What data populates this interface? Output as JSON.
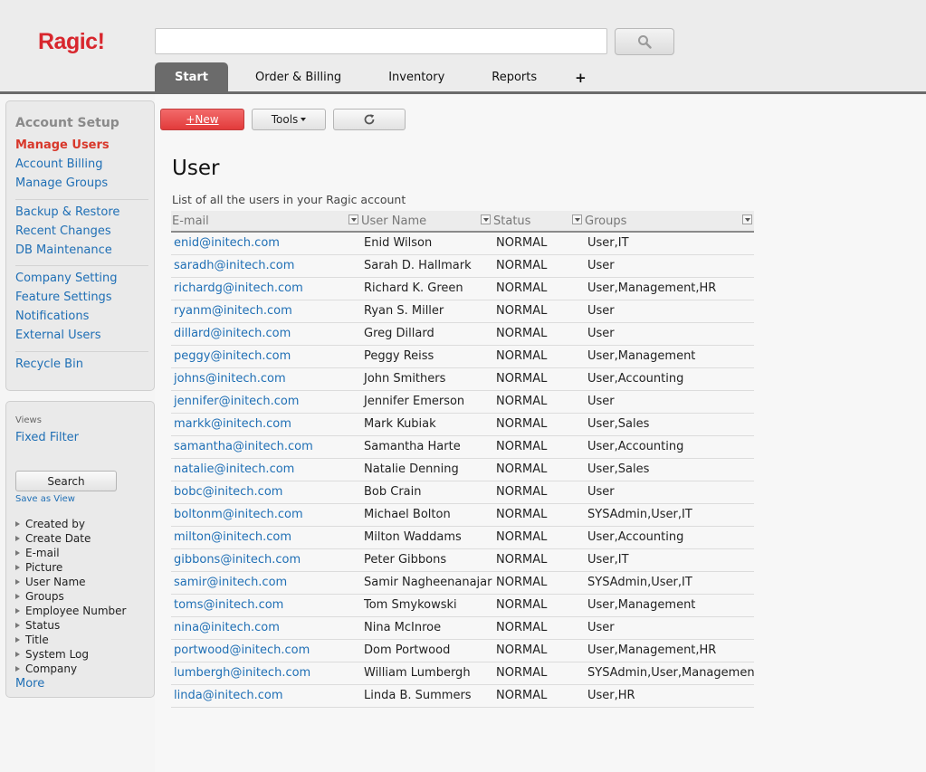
{
  "app": {
    "logo": "Ragic!",
    "search_placeholder": ""
  },
  "tabs": [
    {
      "label": "Start",
      "active": true
    },
    {
      "label": "Order & Billing"
    },
    {
      "label": "Inventory"
    },
    {
      "label": "Reports"
    },
    {
      "label": "+"
    }
  ],
  "sidebar": {
    "title": "Account Setup",
    "groups": [
      [
        "Manage Users",
        "Account Billing",
        "Manage Groups"
      ],
      [
        "Backup & Restore",
        "Recent Changes",
        "DB Maintenance"
      ],
      [
        "Company Setting",
        "Feature Settings",
        "Notifications",
        "External Users"
      ],
      [
        "Recycle Bin"
      ]
    ],
    "active_item": "Manage Users"
  },
  "views": {
    "label": "Views",
    "fixed_filter": "Fixed Filter",
    "search_button": "Search",
    "save_as_view": "Save as View",
    "fields": [
      "Created by",
      "Create Date",
      "E-mail",
      "Picture",
      "User Name",
      "Groups",
      "Employee Number",
      "Status",
      "Title",
      "System Log",
      "Company"
    ],
    "more": "More"
  },
  "toolbar": {
    "new_label": "+New",
    "tools_label": "Tools",
    "refresh_icon": "refresh-icon"
  },
  "main": {
    "title": "User",
    "subtitle": "List of all the users in your Ragic account"
  },
  "table": {
    "columns": [
      "E-mail",
      "User Name",
      "Status",
      "Groups"
    ],
    "rows": [
      [
        "enid@initech.com",
        "Enid Wilson",
        "NORMAL",
        "User,IT"
      ],
      [
        "saradh@initech.com",
        "Sarah D. Hallmark",
        "NORMAL",
        "User"
      ],
      [
        "richardg@initech.com",
        "Richard K. Green",
        "NORMAL",
        "User,Management,HR"
      ],
      [
        "ryanm@initech.com",
        "Ryan S. Miller",
        "NORMAL",
        "User"
      ],
      [
        "dillard@initech.com",
        "Greg Dillard",
        "NORMAL",
        "User"
      ],
      [
        "peggy@initech.com",
        "Peggy Reiss",
        "NORMAL",
        "User,Management"
      ],
      [
        "johns@initech.com",
        "John Smithers",
        "NORMAL",
        "User,Accounting"
      ],
      [
        "jennifer@initech.com",
        "Jennifer Emerson",
        "NORMAL",
        "User"
      ],
      [
        "markk@initech.com",
        "Mark Kubiak",
        "NORMAL",
        "User,Sales"
      ],
      [
        "samantha@initech.com",
        "Samantha Harte",
        "NORMAL",
        "User,Accounting"
      ],
      [
        "natalie@initech.com",
        "Natalie Denning",
        "NORMAL",
        "User,Sales"
      ],
      [
        "bobc@initech.com",
        "Bob Crain",
        "NORMAL",
        "User"
      ],
      [
        "boltonm@initech.com",
        "Michael Bolton",
        "NORMAL",
        "SYSAdmin,User,IT"
      ],
      [
        "milton@initech.com",
        "Milton Waddams",
        "NORMAL",
        "User,Accounting"
      ],
      [
        "gibbons@initech.com",
        "Peter Gibbons",
        "NORMAL",
        "User,IT"
      ],
      [
        "samir@initech.com",
        "Samir Nagheenanajar",
        "NORMAL",
        "SYSAdmin,User,IT"
      ],
      [
        "toms@initech.com",
        "Tom Smykowski",
        "NORMAL",
        "User,Management"
      ],
      [
        "nina@initech.com",
        "Nina McInroe",
        "NORMAL",
        "User"
      ],
      [
        "portwood@initech.com",
        "Dom Portwood",
        "NORMAL",
        "User,Management,HR"
      ],
      [
        "lumbergh@initech.com",
        "William Lumbergh",
        "NORMAL",
        "SYSAdmin,User,Management"
      ],
      [
        "linda@initech.com",
        "Linda B. Summers",
        "NORMAL",
        "User,HR"
      ]
    ]
  },
  "colors": {
    "brand_red": "#d8262d",
    "link_blue": "#1f6fb5",
    "active_tab": "#6b6b6b",
    "new_button": "#e23b3b"
  }
}
